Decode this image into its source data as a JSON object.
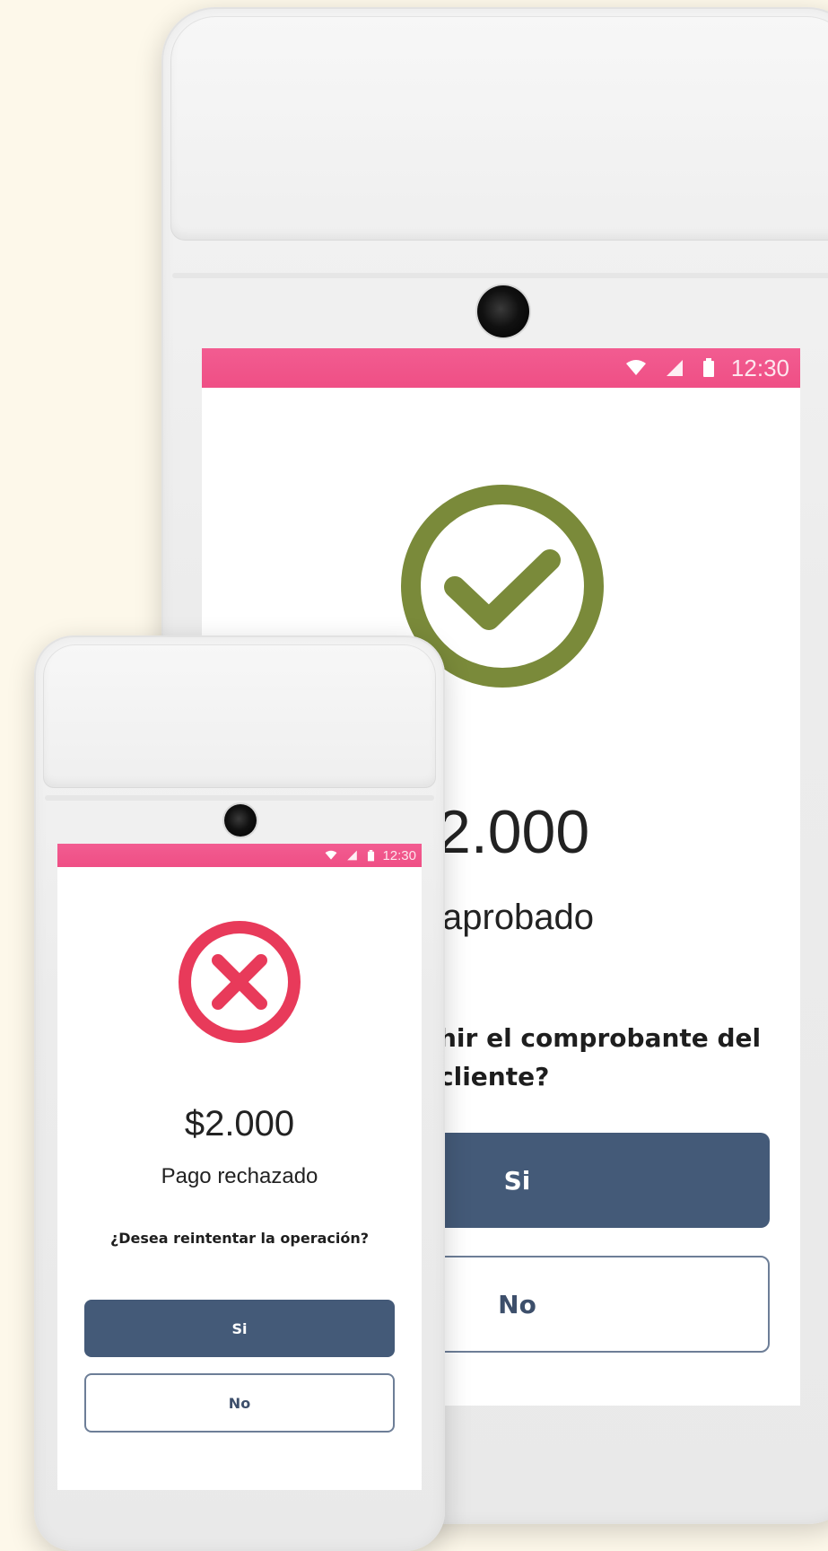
{
  "back_device": {
    "status_bar": {
      "time": "12:30"
    },
    "result_icon": "check-circle-icon",
    "amount": "2.000",
    "status_message": "aprobado",
    "question_line1": "hir el comprobante del",
    "question_line2": "cliente?",
    "yes_label": "Si",
    "no_label": "No"
  },
  "front_device": {
    "status_bar": {
      "time": "12:30"
    },
    "result_icon": "x-circle-icon",
    "amount": "$2.000",
    "status_message": "Pago rechazado",
    "question": "¿Desea reintentar la operación?",
    "yes_label": "Si",
    "no_label": "No"
  },
  "colors": {
    "background": "#fdf8ea",
    "status_bar": "#f0528a",
    "success": "#7a8a3a",
    "error": "#e83a5a",
    "primary_button": "#445a78"
  }
}
